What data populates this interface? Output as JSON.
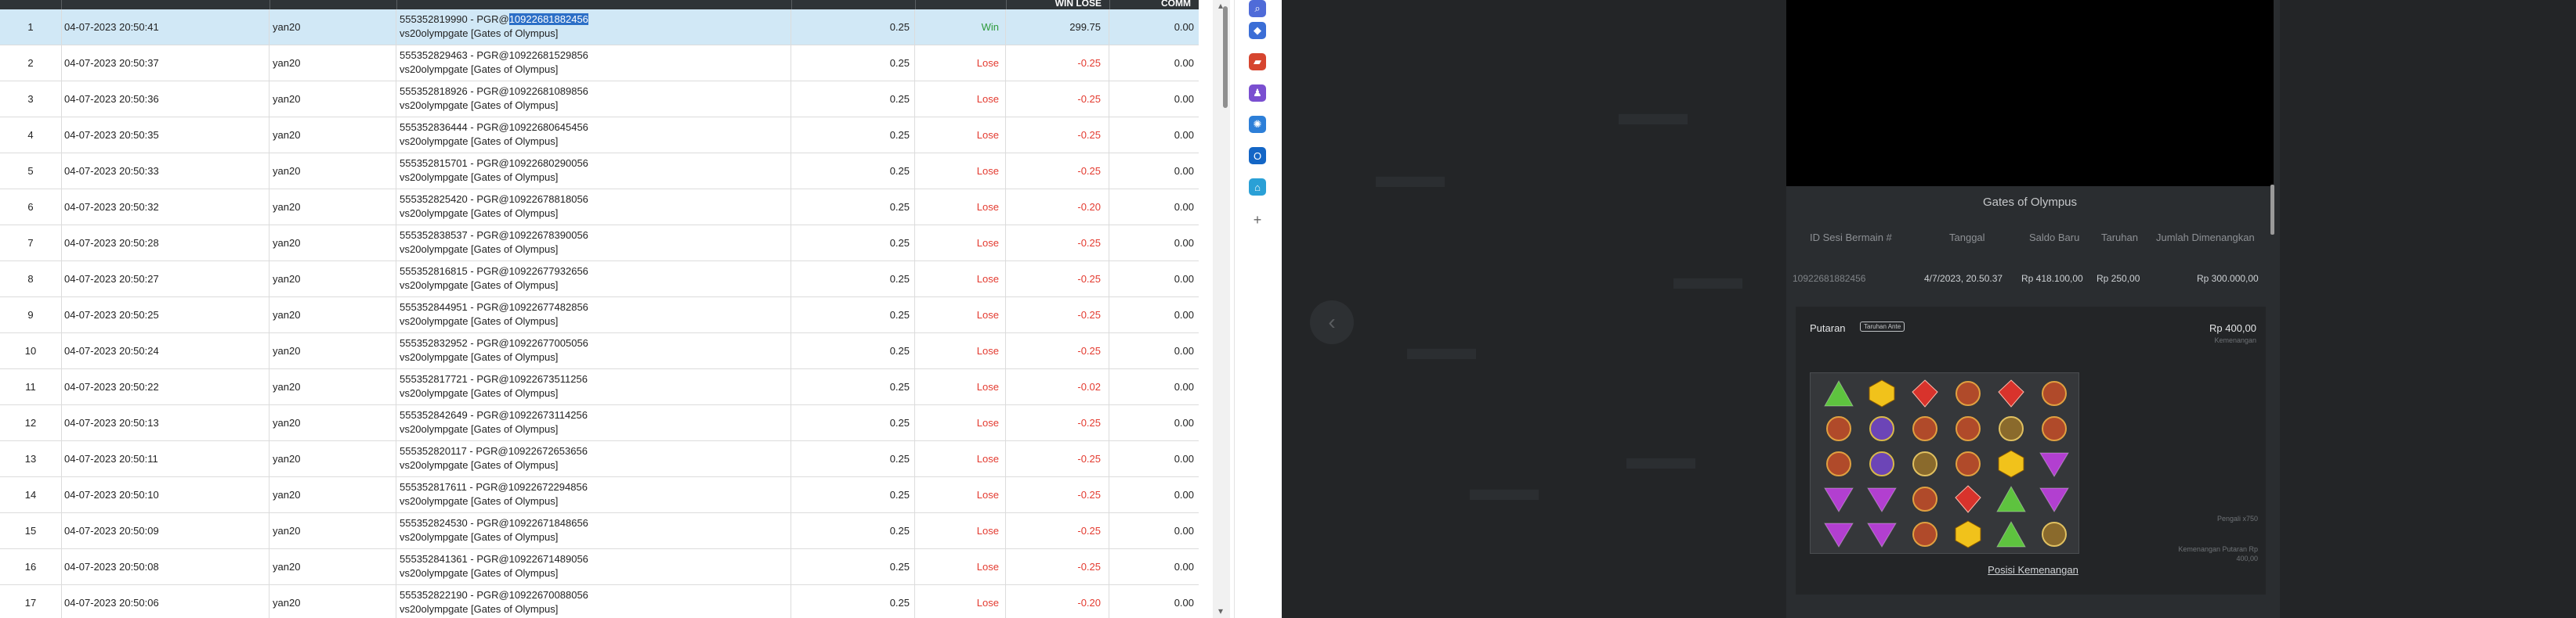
{
  "table": {
    "columns": [
      "",
      "",
      "",
      "",
      "",
      "",
      "WIN LOSE",
      "COMM"
    ],
    "rows": [
      {
        "no": "1",
        "date": "04-07-2023 20:50:41",
        "user": "yan20",
        "ref_prefix": "555352819990 - PGR@",
        "ref_hl": "10922681882456",
        "ref_suffix": "",
        "game": "vs20olympgate [Gates of Olympus]",
        "bet": "0.25",
        "result": "Win",
        "winlose": "299.75",
        "comm": "0.00"
      },
      {
        "no": "2",
        "date": "04-07-2023 20:50:37",
        "user": "yan20",
        "ref_prefix": "555352829463 - PGR@10922681529856",
        "ref_hl": "",
        "ref_suffix": "",
        "game": "vs20olympgate [Gates of Olympus]",
        "bet": "0.25",
        "result": "Lose",
        "winlose": "-0.25",
        "comm": "0.00"
      },
      {
        "no": "3",
        "date": "04-07-2023 20:50:36",
        "user": "yan20",
        "ref_prefix": "555352818926 - PGR@10922681089856",
        "ref_hl": "",
        "ref_suffix": "",
        "game": "vs20olympgate [Gates of Olympus]",
        "bet": "0.25",
        "result": "Lose",
        "winlose": "-0.25",
        "comm": "0.00"
      },
      {
        "no": "4",
        "date": "04-07-2023 20:50:35",
        "user": "yan20",
        "ref_prefix": "555352836444 - PGR@10922680645456",
        "ref_hl": "",
        "ref_suffix": "",
        "game": "vs20olympgate [Gates of Olympus]",
        "bet": "0.25",
        "result": "Lose",
        "winlose": "-0.25",
        "comm": "0.00"
      },
      {
        "no": "5",
        "date": "04-07-2023 20:50:33",
        "user": "yan20",
        "ref_prefix": "555352815701 - PGR@10922680290056",
        "ref_hl": "",
        "ref_suffix": "",
        "game": "vs20olympgate [Gates of Olympus]",
        "bet": "0.25",
        "result": "Lose",
        "winlose": "-0.25",
        "comm": "0.00"
      },
      {
        "no": "6",
        "date": "04-07-2023 20:50:32",
        "user": "yan20",
        "ref_prefix": "555352825420 - PGR@10922678818056",
        "ref_hl": "",
        "ref_suffix": "",
        "game": "vs20olympgate [Gates of Olympus]",
        "bet": "0.25",
        "result": "Lose",
        "winlose": "-0.20",
        "comm": "0.00"
      },
      {
        "no": "7",
        "date": "04-07-2023 20:50:28",
        "user": "yan20",
        "ref_prefix": "555352838537 - PGR@10922678390056",
        "ref_hl": "",
        "ref_suffix": "",
        "game": "vs20olympgate [Gates of Olympus]",
        "bet": "0.25",
        "result": "Lose",
        "winlose": "-0.25",
        "comm": "0.00"
      },
      {
        "no": "8",
        "date": "04-07-2023 20:50:27",
        "user": "yan20",
        "ref_prefix": "555352816815 - PGR@10922677932656",
        "ref_hl": "",
        "ref_suffix": "",
        "game": "vs20olympgate [Gates of Olympus]",
        "bet": "0.25",
        "result": "Lose",
        "winlose": "-0.25",
        "comm": "0.00"
      },
      {
        "no": "9",
        "date": "04-07-2023 20:50:25",
        "user": "yan20",
        "ref_prefix": "555352844951 - PGR@10922677482856",
        "ref_hl": "",
        "ref_suffix": "",
        "game": "vs20olympgate [Gates of Olympus]",
        "bet": "0.25",
        "result": "Lose",
        "winlose": "-0.25",
        "comm": "0.00"
      },
      {
        "no": "10",
        "date": "04-07-2023 20:50:24",
        "user": "yan20",
        "ref_prefix": "555352832952 - PGR@10922677005056",
        "ref_hl": "",
        "ref_suffix": "",
        "game": "vs20olympgate [Gates of Olympus]",
        "bet": "0.25",
        "result": "Lose",
        "winlose": "-0.25",
        "comm": "0.00"
      },
      {
        "no": "11",
        "date": "04-07-2023 20:50:22",
        "user": "yan20",
        "ref_prefix": "555352817721 - PGR@10922673511256",
        "ref_hl": "",
        "ref_suffix": "",
        "game": "vs20olympgate [Gates of Olympus]",
        "bet": "0.25",
        "result": "Lose",
        "winlose": "-0.02",
        "comm": "0.00"
      },
      {
        "no": "12",
        "date": "04-07-2023 20:50:13",
        "user": "yan20",
        "ref_prefix": "555352842649 - PGR@10922673114256",
        "ref_hl": "",
        "ref_suffix": "",
        "game": "vs20olympgate [Gates of Olympus]",
        "bet": "0.25",
        "result": "Lose",
        "winlose": "-0.25",
        "comm": "0.00"
      },
      {
        "no": "13",
        "date": "04-07-2023 20:50:11",
        "user": "yan20",
        "ref_prefix": "555352820117 - PGR@10922672653656",
        "ref_hl": "",
        "ref_suffix": "",
        "game": "vs20olympgate [Gates of Olympus]",
        "bet": "0.25",
        "result": "Lose",
        "winlose": "-0.25",
        "comm": "0.00"
      },
      {
        "no": "14",
        "date": "04-07-2023 20:50:10",
        "user": "yan20",
        "ref_prefix": "555352817611 - PGR@10922672294856",
        "ref_hl": "",
        "ref_suffix": "",
        "game": "vs20olympgate [Gates of Olympus]",
        "bet": "0.25",
        "result": "Lose",
        "winlose": "-0.25",
        "comm": "0.00"
      },
      {
        "no": "15",
        "date": "04-07-2023 20:50:09",
        "user": "yan20",
        "ref_prefix": "555352824530 - PGR@10922671848656",
        "ref_hl": "",
        "ref_suffix": "",
        "game": "vs20olympgate [Gates of Olympus]",
        "bet": "0.25",
        "result": "Lose",
        "winlose": "-0.25",
        "comm": "0.00"
      },
      {
        "no": "16",
        "date": "04-07-2023 20:50:08",
        "user": "yan20",
        "ref_prefix": "555352841361 - PGR@10922671489056",
        "ref_hl": "",
        "ref_suffix": "",
        "game": "vs20olympgate [Gates of Olympus]",
        "bet": "0.25",
        "result": "Lose",
        "winlose": "-0.25",
        "comm": "0.00"
      },
      {
        "no": "17",
        "date": "04-07-2023 20:50:06",
        "user": "yan20",
        "ref_prefix": "555352822190 - PGR@10922670088056",
        "ref_hl": "",
        "ref_suffix": "",
        "game": "vs20olympgate [Gates of Olympus]",
        "bet": "0.25",
        "result": "Lose",
        "winlose": "-0.20",
        "comm": "0.00"
      }
    ]
  },
  "sidebar_icons": [
    {
      "name": "search-icon",
      "color": "#4f6bd8",
      "glyph": "⌕"
    },
    {
      "name": "tag-icon",
      "color": "#3b6ed6",
      "glyph": "◆"
    },
    {
      "name": "briefcase-icon",
      "color": "#d6452f",
      "glyph": "▰"
    },
    {
      "name": "chess-icon",
      "color": "#7a4fd0",
      "glyph": "♟"
    },
    {
      "name": "copilot-icon",
      "color": "#2d7fd8",
      "glyph": "✺"
    },
    {
      "name": "outlook-icon",
      "color": "#1466c6",
      "glyph": "O"
    },
    {
      "name": "shopping-icon",
      "color": "#2aa0d6",
      "glyph": "⌂"
    },
    {
      "name": "add-icon",
      "color": "#ffffff",
      "glyph": "+"
    }
  ],
  "game_panel": {
    "title": "Gates of Olympus",
    "headers": [
      "ID Sesi Bermain #",
      "Tanggal",
      "Saldo Baru",
      "Taruhan",
      "Jumlah Dimenangkan"
    ],
    "values": [
      "10922681882456",
      "4/7/2023, 20.50.37",
      "Rp 418.100,00",
      "Rp 250,00",
      "Rp 300.000,00"
    ],
    "spin_label": "Putaran",
    "spin_tag": "Taruhan Ante",
    "spin_win": "Rp 400,00",
    "spin_win_sub": "Kemenangan",
    "multiplier_label": "Pengali x750",
    "total_win_label": "Kemenangan Putaran Rp",
    "total_win_value": "400,00",
    "link_label": "Posisi Kemenangan",
    "grid": [
      [
        "green",
        "yellow",
        "red",
        "purple",
        "red",
        "purple"
      ],
      [
        "purple",
        "blue",
        "purple",
        "purple",
        "multiplier",
        "purple"
      ],
      [
        "purple",
        "blue",
        "multiplier",
        "purple",
        "yellow",
        "pink"
      ],
      [
        "pink",
        "pink",
        "purple",
        "red",
        "green",
        "pink"
      ],
      [
        "pink",
        "pink",
        "purple",
        "yellow",
        "green",
        "multiplier"
      ]
    ],
    "colors": {
      "green": "#5ec33f",
      "yellow": "#f1c21b",
      "red": "#d8332c",
      "purple": "#b04a2a",
      "blue": "#6c45b7",
      "pink": "#b23fd0",
      "multiplier": "#8a6a2c"
    }
  }
}
